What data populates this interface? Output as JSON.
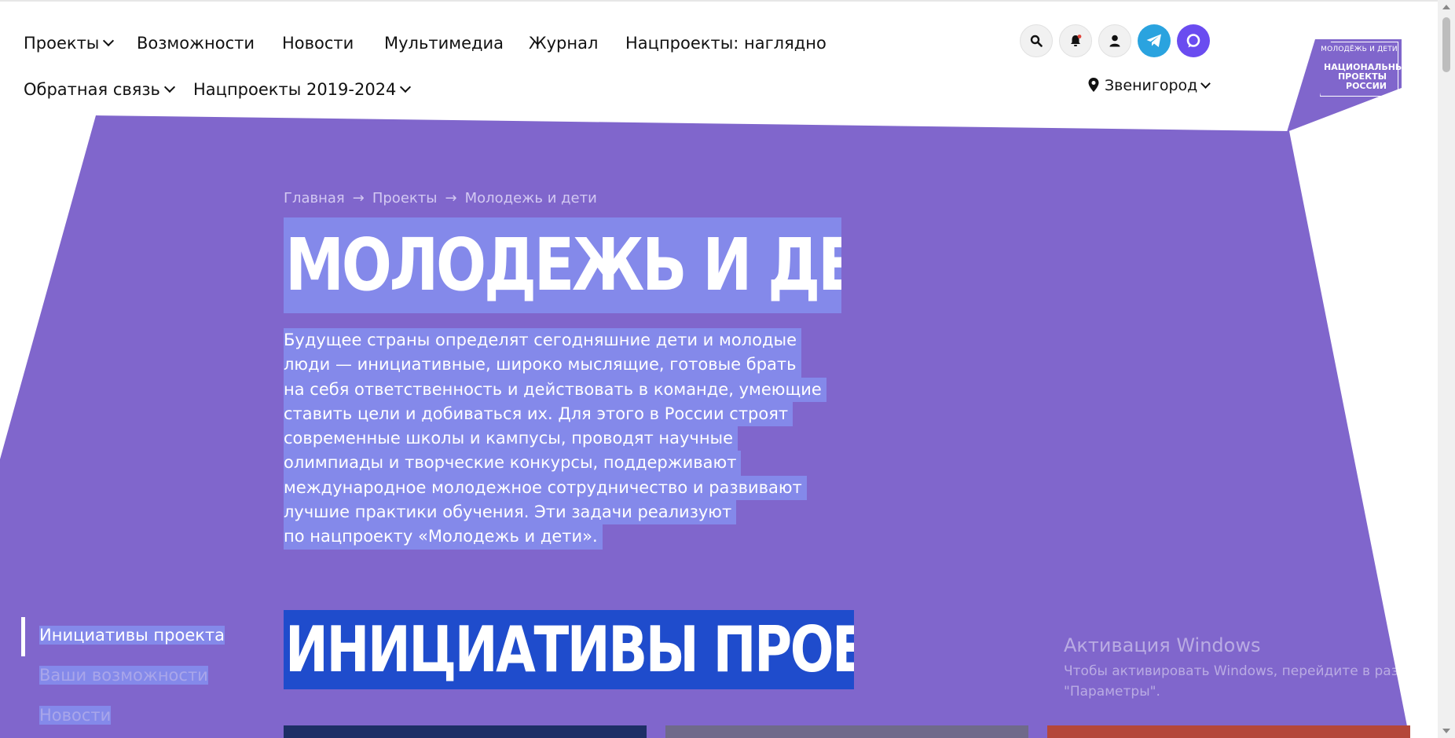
{
  "nav": {
    "row1": [
      {
        "label": "Проекты",
        "dropdown": true
      },
      {
        "label": "Возможности",
        "dropdown": false
      },
      {
        "label": "Новости",
        "dropdown": false
      },
      {
        "label": "Мультимедиа",
        "dropdown": false
      },
      {
        "label": "Журнал",
        "dropdown": false
      },
      {
        "label": "Нацпроекты: наглядно",
        "dropdown": false
      }
    ],
    "row2": [
      {
        "label": "Обратная связь",
        "dropdown": true
      },
      {
        "label": "Нацпроекты 2019-2024",
        "dropdown": true
      }
    ]
  },
  "header_icons": [
    "search-icon",
    "bell-icon",
    "user-icon",
    "telegram-icon",
    "max-icon"
  ],
  "city": "Звенигород",
  "logo": {
    "top": "МОЛОДЁЖЬ И ДЕТИ",
    "lines": [
      "НАЦИОНАЛЬНЫЕ",
      "ПРОЕКТЫ",
      "РОССИИ"
    ]
  },
  "breadcrumbs": [
    "Главная",
    "Проекты",
    "Молодежь и дети"
  ],
  "breadcrumb_separator": "→",
  "title": "МОЛОДЕЖЬ И ДЕТИ",
  "description_lines": [
    "Будущее страны определят сегодняшние дети и молодые",
    "люди — инициативные, широко мыслящие, готовые брать",
    "на себя ответственность и действовать в команде, умеющие",
    "ставить цели и добиваться их. Для этого в России строят",
    "современные школы и кампусы, проводят научные",
    "олимпиады и творческие конкурсы, поддерживают",
    "международное молодежное сотрудничество и развивают",
    "лучшие практики обучения. Эти задачи реализуют",
    "по нацпроекту «Молодежь и дети»."
  ],
  "section_title": "ИНИЦИАТИВЫ ПРОЕКТА",
  "side_nav": [
    "Инициативы проекта",
    "Ваши возможности",
    "Новости"
  ],
  "watermark": {
    "title": "Активация Windows",
    "line1": "Чтобы активировать Windows, перейдите в раздел",
    "line2": "\"Параметры\"."
  },
  "colors": {
    "hero": "#8066cc",
    "selection": "#8489ea",
    "section": "#1f4ccc",
    "telegram": "#2aa3df",
    "max": "#6a4cf0"
  }
}
